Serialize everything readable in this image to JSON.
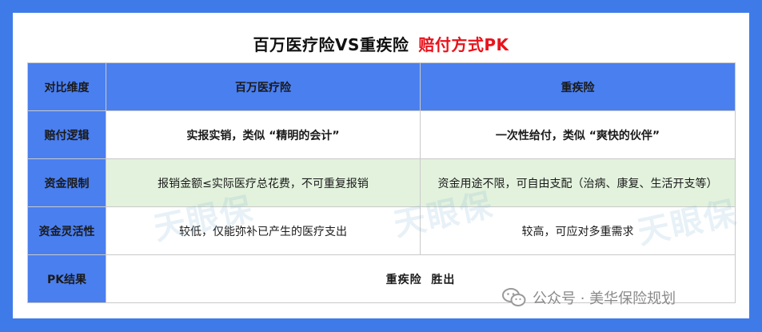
{
  "title": {
    "main": "百万医疗险VS重疾险",
    "accent": "赔付方式PK"
  },
  "table": {
    "header": {
      "dimension": "对比维度",
      "col1": "百万医疗险",
      "col2": "重疾险"
    },
    "rows": [
      {
        "label": "赔付逻辑",
        "col1": "实报实销，类似 “精明的会计”",
        "col2": "一次性给付，类似 “爽快的伙伴”"
      },
      {
        "label": "资金限制",
        "col1": "报销金额≤实际医疗总花费，不可重复报销",
        "col2": "资金用途不限，可自由支配（治病、康复、生活开支等）"
      },
      {
        "label": "资金灵活性",
        "col1": "较低，仅能弥补已产生的医疗支出",
        "col2": "较高，可应对多重需求"
      }
    ],
    "result": {
      "label": "PK结果",
      "value": "重疾险  胜出"
    }
  },
  "watermark": {
    "text": "天眼保"
  },
  "credit": {
    "icon": "wechat-icon",
    "text": "公众号 · 美华保险规划"
  },
  "colors": {
    "frame": "#3e7be8",
    "header": "#4a7ff0",
    "accent": "#e8131b",
    "highlight_row": "#e3f2dd"
  }
}
